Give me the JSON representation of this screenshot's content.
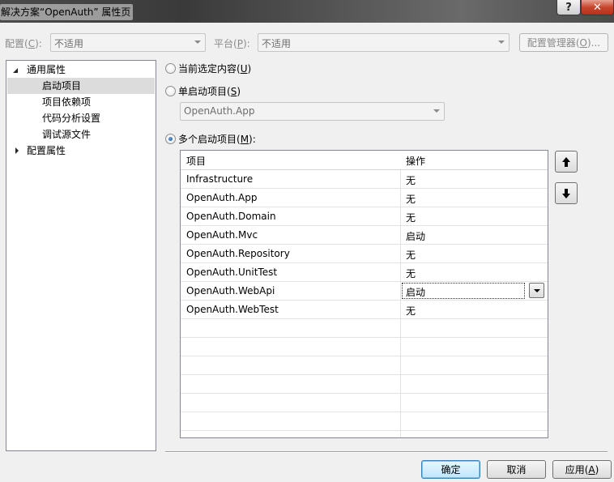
{
  "window": {
    "title": "解决方案“OpenAuth” 属性页",
    "help_label": "?",
    "close_label": "✕"
  },
  "top": {
    "config_label": "配置(",
    "config_key": "C",
    "config_label_end": "):",
    "config_value": "不适用",
    "platform_label": "平台(",
    "platform_key": "P",
    "platform_label_end": "):",
    "platform_value": "不适用",
    "config_manager": "配置管理器(",
    "config_manager_key": "O",
    "config_manager_end": ")..."
  },
  "tree": {
    "common": "通用属性",
    "startup": "启动项目",
    "deps": "项目依赖项",
    "code_analysis": "代码分析设置",
    "debug_source": "调试源文件",
    "config_props": "配置属性"
  },
  "options": {
    "current_selection": "当前选定内容(",
    "current_selection_key": "U",
    "current_selection_end": ")",
    "single": "单启动项目(",
    "single_key": "S",
    "single_end": ")",
    "single_value": "OpenAuth.App",
    "multiple": "多个启动项目(",
    "multiple_key": "M",
    "multiple_end": "):"
  },
  "grid": {
    "col_project": "项目",
    "col_action": "操作",
    "rows": [
      {
        "project": "Infrastructure",
        "action": "无"
      },
      {
        "project": "OpenAuth.App",
        "action": "无"
      },
      {
        "project": "OpenAuth.Domain",
        "action": "无"
      },
      {
        "project": "OpenAuth.Mvc",
        "action": "启动"
      },
      {
        "project": "OpenAuth.Repository",
        "action": "无"
      },
      {
        "project": "OpenAuth.UnitTest",
        "action": "无"
      },
      {
        "project": "OpenAuth.WebApi",
        "action": "启动"
      },
      {
        "project": "OpenAuth.WebTest",
        "action": "无"
      }
    ]
  },
  "move": {
    "up": "🡅",
    "down": "🡇"
  },
  "buttons": {
    "ok": "确定",
    "cancel": "取消",
    "apply": "应用(",
    "apply_key": "A",
    "apply_end": ")"
  }
}
